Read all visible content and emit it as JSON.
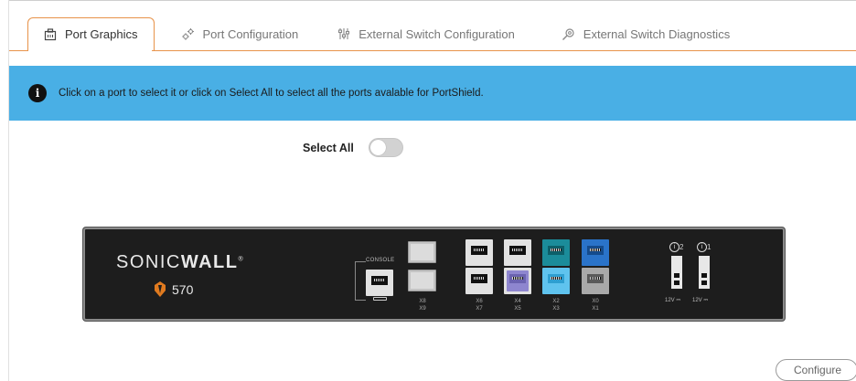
{
  "tabs": [
    {
      "label": "Port Graphics",
      "icon": "port-graphics-icon",
      "active": true
    },
    {
      "label": "Port Configuration",
      "icon": "gears-icon",
      "active": false
    },
    {
      "label": "External Switch Configuration",
      "icon": "sliders-icon",
      "active": false
    },
    {
      "label": "External Switch Diagnostics",
      "icon": "diagnostics-icon",
      "active": false
    }
  ],
  "banner": {
    "text": "Click on a port to select it or click on Select All to select all the ports avalable for PortShield.",
    "color": "#49afe5",
    "icon": "info-icon"
  },
  "select_all": {
    "label": "Select All",
    "checked": false
  },
  "appliance": {
    "brand_light": "SONIC",
    "brand_bold": "WALL",
    "brand_mark": "®",
    "model": "570",
    "console_label": "CONSOLE",
    "port_labels": {
      "sfp": [
        "X8",
        "X9"
      ],
      "pair1": [
        "X6",
        "X7"
      ],
      "pair2": [
        "X4",
        "X5"
      ],
      "pair3": [
        "X2",
        "X3"
      ],
      "pair4": [
        "X0",
        "X1"
      ]
    },
    "psu": [
      {
        "num": "2",
        "label": "12V ⎓"
      },
      {
        "num": "1",
        "label": "12V ⎓"
      }
    ],
    "port_colors": {
      "white": "#e2e2e2",
      "purple": "#8e86cf",
      "teal": "#1b8c9a",
      "light_blue": "#5fc3ee",
      "blue": "#2a73c9",
      "gray": "#a9a9a9"
    }
  },
  "actions": {
    "configure": "Configure"
  },
  "colors": {
    "accent": "#e8934a"
  }
}
